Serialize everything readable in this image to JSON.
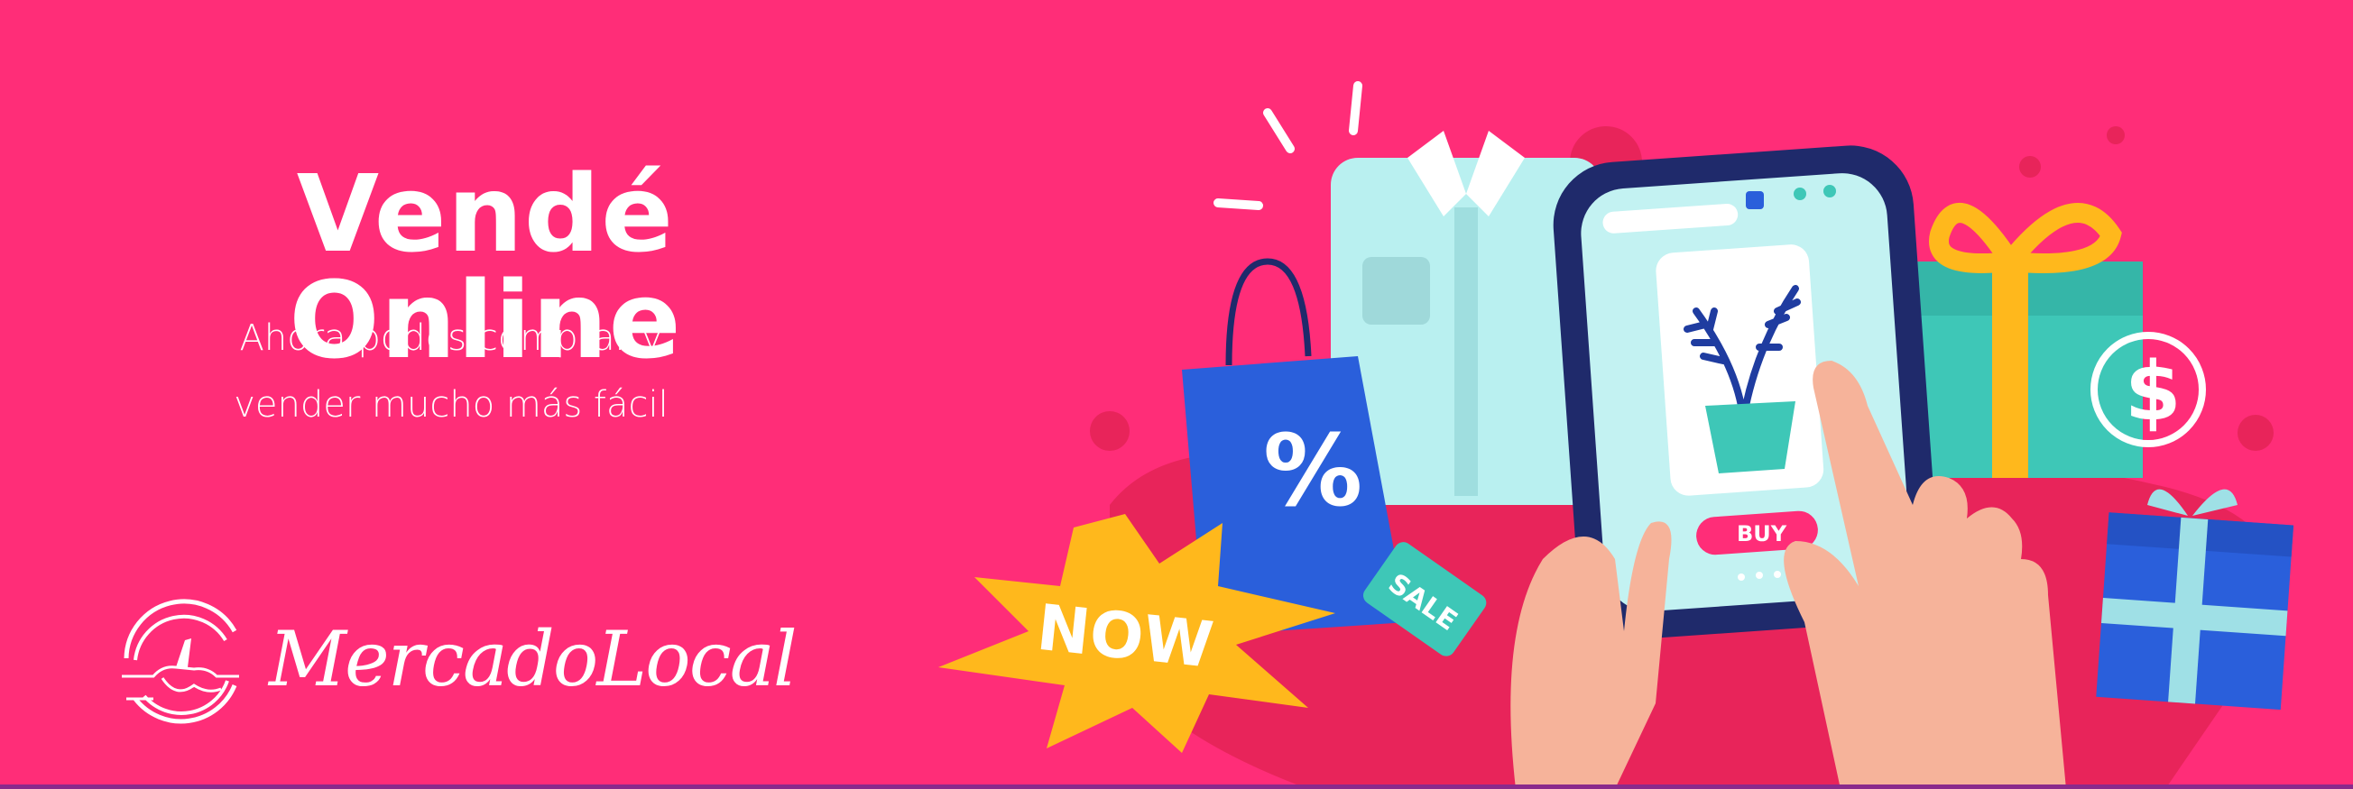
{
  "banner": {
    "title": "Vendé Online",
    "subtitle_line1": "Ahora podes comprar y",
    "subtitle_line2": "vender mucho más fácil",
    "background_color": "#ff2d78"
  },
  "logo": {
    "text": "MercadoLocal",
    "icon": "handshake-circle-icon"
  },
  "illustration": {
    "badge_now": "NOW",
    "tag_sale": "SALE",
    "buy_button": "BUY",
    "bag_symbol": "%",
    "coin_symbol": "$"
  }
}
